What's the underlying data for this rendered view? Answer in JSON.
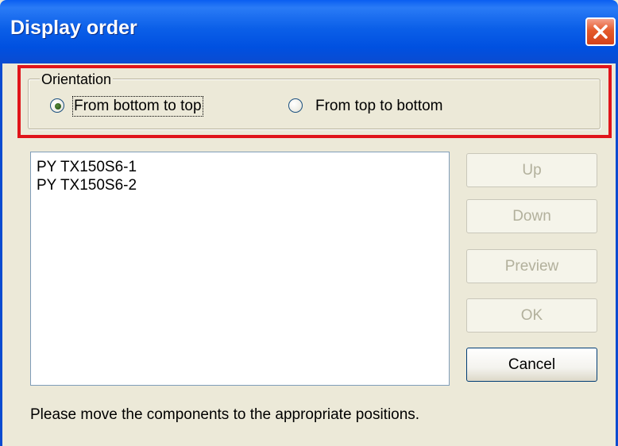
{
  "window": {
    "title": "Display order"
  },
  "icons": {
    "close": "close-x-icon"
  },
  "orientation": {
    "legend": "Orientation",
    "options": [
      {
        "label": "From bottom to top",
        "selected": true
      },
      {
        "label": "From top to bottom",
        "selected": false
      }
    ]
  },
  "list": {
    "items": [
      "PY TX150S6-1",
      "PY TX150S6-2"
    ]
  },
  "buttons": {
    "up": "Up",
    "down": "Down",
    "preview": "Preview",
    "ok": "OK",
    "cancel": "Cancel"
  },
  "status": "Please move the components to the appropriate positions.",
  "colors": {
    "titlebar": "#0054e3",
    "highlight": "#e0141a",
    "background": "#ece9d8"
  }
}
